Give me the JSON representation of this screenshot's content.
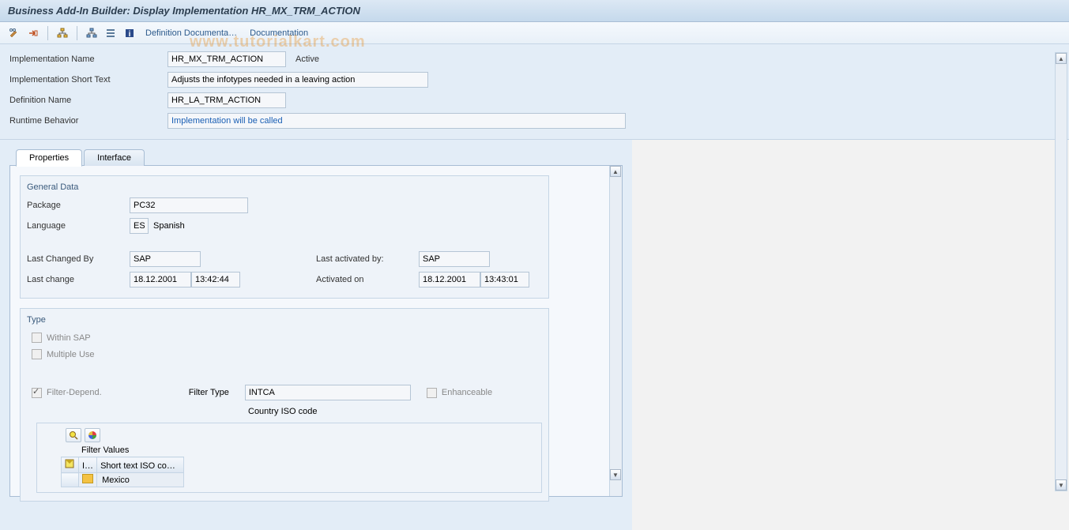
{
  "title": "Business Add-In Builder: Display Implementation HR_MX_TRM_ACTION",
  "toolbar": {
    "links": {
      "def_doc": "Definition Documenta…",
      "doc": "Documentation"
    }
  },
  "header": {
    "impl_name_label": "Implementation Name",
    "impl_name_value": "HR_MX_TRM_ACTION",
    "impl_status": "Active",
    "impl_short_label": "Implementation Short Text",
    "impl_short_value": "Adjusts the infotypes needed in a leaving action",
    "def_name_label": "Definition Name",
    "def_name_value": "HR_LA_TRM_ACTION",
    "runtime_label": "Runtime Behavior",
    "runtime_value": "Implementation will be called"
  },
  "tabs": {
    "properties": "Properties",
    "interface": "Interface"
  },
  "general": {
    "title": "General Data",
    "package_label": "Package",
    "package_value": "PC32",
    "language_label": "Language",
    "language_code": "ES",
    "language_text": "Spanish",
    "last_changed_by_label": "Last Changed By",
    "last_changed_by_value": "SAP",
    "last_change_label": "Last change",
    "last_change_date": "18.12.2001",
    "last_change_time": "13:42:44",
    "last_activated_by_label": "Last activated by:",
    "last_activated_by_value": "SAP",
    "activated_on_label": "Activated on",
    "activated_on_date": "18.12.2001",
    "activated_on_time": "13:43:01"
  },
  "type": {
    "title": "Type",
    "within_sap": "Within SAP",
    "multiple_use": "Multiple Use",
    "filter_depend": "Filter-Depend.",
    "filter_type_label": "Filter Type",
    "filter_type_value": "INTCA",
    "enhanceable": "Enhanceable",
    "filter_caption": "Country ISO code"
  },
  "filter_values": {
    "title": "Filter Values",
    "col_i": "I…",
    "col_short": "Short text ISO co…",
    "row0": "Mexico"
  },
  "watermark": "www.tutorialkart.com"
}
